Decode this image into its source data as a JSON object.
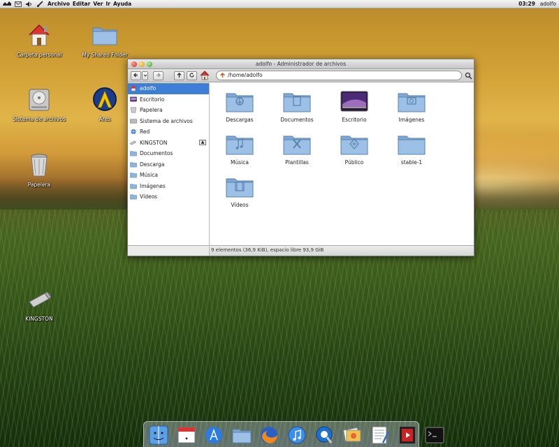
{
  "top_panel": {
    "menus": [
      "Archivo",
      "Editar",
      "Ver",
      "Ir",
      "Ayuda"
    ],
    "clock": "03:29",
    "user": "adolfo"
  },
  "desktop": {
    "icons": [
      {
        "label": "Carpeta personal",
        "icon": "home-icon"
      },
      {
        "label": "My Shared Folder",
        "icon": "folder-icon"
      },
      {
        "label": "Sistema de archivos",
        "icon": "hard-drive-icon"
      },
      {
        "label": "Ares",
        "icon": "ares-icon"
      },
      {
        "label": "Papelera",
        "icon": "trash-icon"
      },
      {
        "label": "KINGSTON",
        "icon": "usb-drive-icon"
      }
    ]
  },
  "window": {
    "title": "adolfo - Administrador de archivos",
    "location": "/home/adolfo",
    "sidebar": [
      {
        "label": "adolfo",
        "icon": "home-icon",
        "selected": true
      },
      {
        "label": "Escritorio",
        "icon": "desktop-icon"
      },
      {
        "label": "Papelera",
        "icon": "trash-icon"
      },
      {
        "label": "Sistema de archivos",
        "icon": "hard-drive-icon"
      },
      {
        "label": "Red",
        "icon": "network-icon"
      },
      {
        "label": "KINGSTON",
        "icon": "usb-drive-icon",
        "eject": true
      },
      {
        "label": "Documentos",
        "icon": "folder-icon"
      },
      {
        "label": "Descarga",
        "icon": "folder-icon"
      },
      {
        "label": "Música",
        "icon": "folder-icon"
      },
      {
        "label": "Imágenes",
        "icon": "folder-icon"
      },
      {
        "label": "Vídeos",
        "icon": "folder-icon"
      }
    ],
    "items": [
      {
        "label": "Descargas",
        "icon": "download-folder-icon"
      },
      {
        "label": "Documentos",
        "icon": "documents-folder-icon"
      },
      {
        "label": "Escritorio",
        "icon": "desktop-folder-icon"
      },
      {
        "label": "Imágenes",
        "icon": "pictures-folder-icon"
      },
      {
        "label": "Música",
        "icon": "music-folder-icon"
      },
      {
        "label": "Plantillas",
        "icon": "templates-folder-icon"
      },
      {
        "label": "Público",
        "icon": "public-folder-icon"
      },
      {
        "label": "stable-1",
        "icon": "folder-icon"
      },
      {
        "label": "Vídeos",
        "icon": "videos-folder-icon"
      }
    ],
    "status": "9 elementos (36,9 KiB), espacio libre 93,9 GiB"
  },
  "dock": {
    "items": [
      "finder-icon",
      "calendar-icon",
      "appstore-icon",
      "folder-icon",
      "firefox-icon",
      "itunes-icon",
      "quicktime-icon",
      "photos-icon",
      "textedit-icon",
      "video-icon",
      "terminal-icon"
    ]
  },
  "colors": {
    "selection": "#3d7fd6",
    "folder_blue": "#8fb4dc"
  }
}
